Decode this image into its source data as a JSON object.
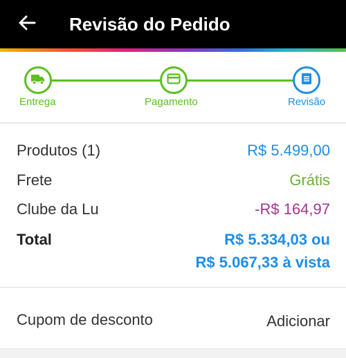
{
  "header": {
    "title": "Revisão do Pedido",
    "back_icon": "arrow-left-icon"
  },
  "colors": {
    "green": "#5bbf1e",
    "blue": "#1c8ee8",
    "purple": "#a0378f",
    "header_bg": "#000000"
  },
  "stepper": {
    "steps": [
      {
        "label": "Entrega",
        "icon": "truck-icon",
        "state": "done"
      },
      {
        "label": "Pagamento",
        "icon": "credit-card-icon",
        "state": "done"
      },
      {
        "label": "Revisão",
        "icon": "list-icon",
        "state": "active"
      }
    ]
  },
  "summary": {
    "products_label": "Produtos (1)",
    "products_value": "R$ 5.499,00",
    "shipping_label": "Frete",
    "shipping_value": "Grátis",
    "club_label": "Clube da Lu",
    "club_value": "-R$ 164,97",
    "total_label": "Total",
    "total_installment": "R$ 5.334,03 ou",
    "total_cash": "R$ 5.067,33 à vista"
  },
  "coupon": {
    "label": "Cupom de desconto",
    "action": "Adicionar"
  }
}
